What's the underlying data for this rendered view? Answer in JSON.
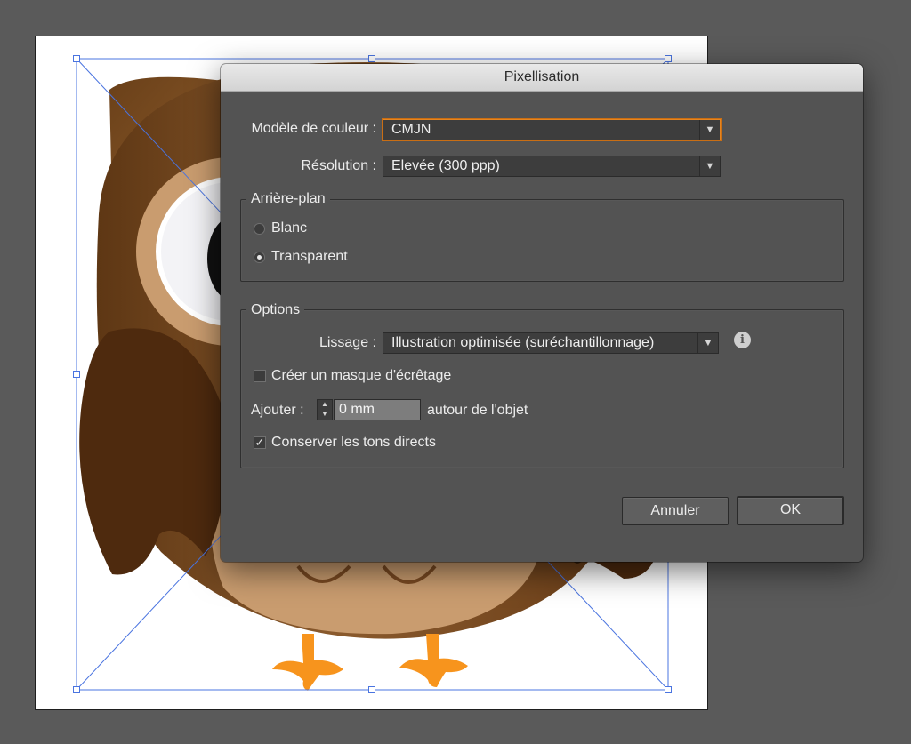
{
  "dialog": {
    "title": "Pixellisation",
    "color_model": {
      "label": "Modèle de couleur :",
      "value": "CMJN"
    },
    "resolution": {
      "label": "Résolution :",
      "value": "Elevée (300 ppp)"
    },
    "background": {
      "title": "Arrière-plan",
      "options": [
        {
          "label": "Blanc",
          "selected": false
        },
        {
          "label": "Transparent",
          "selected": true
        }
      ]
    },
    "options": {
      "title": "Options",
      "antialiasing": {
        "label": "Lissage :",
        "value": "Illustration optimisée (suréchantillonnage)"
      },
      "clipping_mask": {
        "label": "Créer un masque d'écrêtage",
        "checked": false
      },
      "add": {
        "label": "Ajouter :",
        "value": "0 mm",
        "suffix": "autour de l'objet"
      },
      "preserve_spot": {
        "label": "Conserver les tons directs",
        "checked": true
      }
    },
    "buttons": {
      "cancel": "Annuler",
      "ok": "OK"
    }
  },
  "icons": {
    "dropdown_arrow": "▼",
    "stepper_up": "▲",
    "stepper_down": "▼",
    "check_mark": "✓",
    "info": "i"
  },
  "colors": {
    "workspace": "#5a5a5a",
    "dialog_bg": "#535353",
    "focus_ring": "#e7851f",
    "selection": "#4a74e0",
    "owl_body": "#7a4a22",
    "owl_belly": "#c99c6f",
    "owl_feet": "#f7941d"
  }
}
